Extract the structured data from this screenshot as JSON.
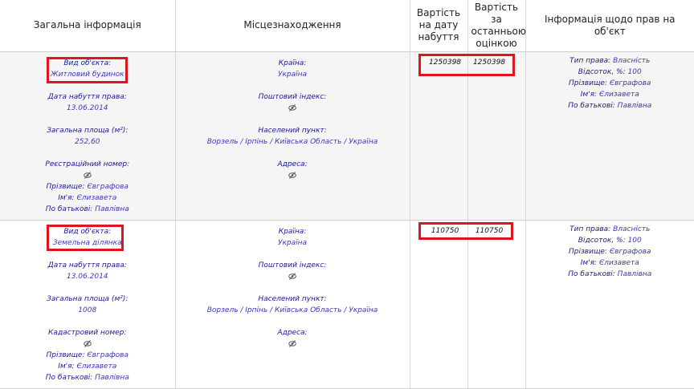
{
  "headers": {
    "general": "Загальна інформація",
    "location": "Місцезнаходження",
    "value_acq_l1": "Вартість",
    "value_acq_l2": "на дату",
    "value_acq_l3": "набуття",
    "value_last_l1": "Вартість за",
    "value_last_l2": "останньою",
    "value_last_l3": "оцінкою",
    "rights": "Інформація щодо прав на об'єкт"
  },
  "rows": [
    {
      "object_type_label": "Вид об'єкта:",
      "object_type": "Житловий будинок",
      "acq_date_label": "Дата набуття права:",
      "acq_date": "13.06.2014",
      "area_label": "Загальна площа (м²):",
      "area": "252,60",
      "reg_label": "Реєстраційний номер:",
      "surname_label": "Прізвище:",
      "surname": "Євграфова",
      "name_label": "Ім'я:",
      "name": "Єлизавета",
      "patronymic_label": "По батькові:",
      "patronymic": "Павлівна",
      "country_label": "Країна:",
      "country": "Україна",
      "postal_label": "Поштовий індекс:",
      "settlement_label": "Населений пункт:",
      "settlement": "Ворзель / Ірпінь / Київська Область / Україна",
      "address_label": "Адреса:",
      "value_acq": "1250398",
      "value_last": "1250398",
      "right_type_label": "Тип права:",
      "right_type": "Власність",
      "percent_label": "Відсоток, %:",
      "percent": "100",
      "r_surname_label": "Прізвище:",
      "r_surname": "Євграфова",
      "r_name_label": "Ім'я:",
      "r_name": "Єлизавета",
      "r_patronymic_label": "По батькові:",
      "r_patronymic": "Павлівна"
    },
    {
      "object_type_label": "Вид об'єкта:",
      "object_type": "Земельна ділянка",
      "acq_date_label": "Дата набуття права:",
      "acq_date": "13.06.2014",
      "area_label": "Загальна площа (м²):",
      "area": "1008",
      "reg_label": "Кадастровий номер:",
      "surname_label": "Прізвище:",
      "surname": "Євграфова",
      "name_label": "Ім'я:",
      "name": "Єлизавета",
      "patronymic_label": "По батькові:",
      "patronymic": "Павлівна",
      "country_label": "Країна:",
      "country": "Україна",
      "postal_label": "Поштовий індекс:",
      "settlement_label": "Населений пункт:",
      "settlement": "Ворзель / Ірпінь / Київська Область / Україна",
      "address_label": "Адреса:",
      "value_acq": "110750",
      "value_last": "110750",
      "right_type_label": "Тип права:",
      "right_type": "Власність",
      "percent_label": "Відсоток, %:",
      "percent": "100",
      "r_surname_label": "Прізвище:",
      "r_surname": "Євграфова",
      "r_name_label": "Ім'я:",
      "r_name": "Єлизавета",
      "r_patronymic_label": "По батькові:",
      "r_patronymic": "Павлівна"
    }
  ],
  "icons": {
    "hidden": "hidden-eye-icon"
  },
  "colors": {
    "highlight": "#e0141e",
    "label": "#1a1a8c",
    "value": "#3b3bb0"
  }
}
